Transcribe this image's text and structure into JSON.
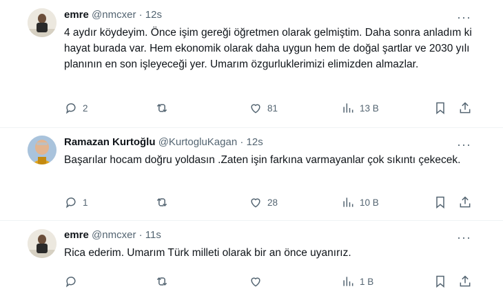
{
  "tweets": [
    {
      "name": "emre",
      "handle": "@nmcxer",
      "dot": "·",
      "time": "12s",
      "text": "4 aydır köydeyim. Önce işim gereği öğretmen olarak gelmiştim. Daha sonra anladım ki hayat burada var. Hem ekonomik olarak daha uygun hem de doğal şartlar ve 2030 yılı planının en son işleyeceği yer. Umarım özgurluklerimizi elimizden almazlar.",
      "replies": "2",
      "retweets": "",
      "likes": "81",
      "views": "13 B"
    },
    {
      "name": "Ramazan Kurtoğlu",
      "handle": "@KurtogluKagan",
      "dot": "·",
      "time": "12s",
      "text": "Başarılar hocam doğru yoldasın .Zaten işin farkına varmayanlar çok sıkıntı çekecek.",
      "replies": "1",
      "retweets": "",
      "likes": "28",
      "views": "10 B"
    },
    {
      "name": "emre",
      "handle": "@nmcxer",
      "dot": "·",
      "time": "11s",
      "text": "Rica ederim. Umarım Türk milleti olarak bir an önce uyanırız.",
      "replies": "",
      "retweets": "",
      "likes": "",
      "views": "1 B"
    }
  ],
  "more_symbol": "···",
  "colors": {
    "text": "#0f1419",
    "muted": "#536471",
    "divider": "#eff3f4"
  }
}
